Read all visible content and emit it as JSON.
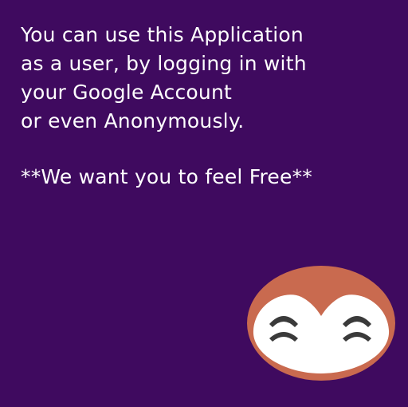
{
  "onboarding": {
    "message_lines": [
      "You can use this Application",
      "as a user, by logging in with",
      "your Google Account",
      "or even Anonymously."
    ],
    "tagline": "**We want you to feel Free**"
  },
  "colors": {
    "background": "#3f0a5f",
    "text": "#ffffff",
    "mascot_head": "#c96a4f",
    "mascot_face": "#ffffff",
    "mascot_eyes": "#3a3a3a"
  },
  "mascot": {
    "icon": "smiling-owl-mascot-icon"
  }
}
